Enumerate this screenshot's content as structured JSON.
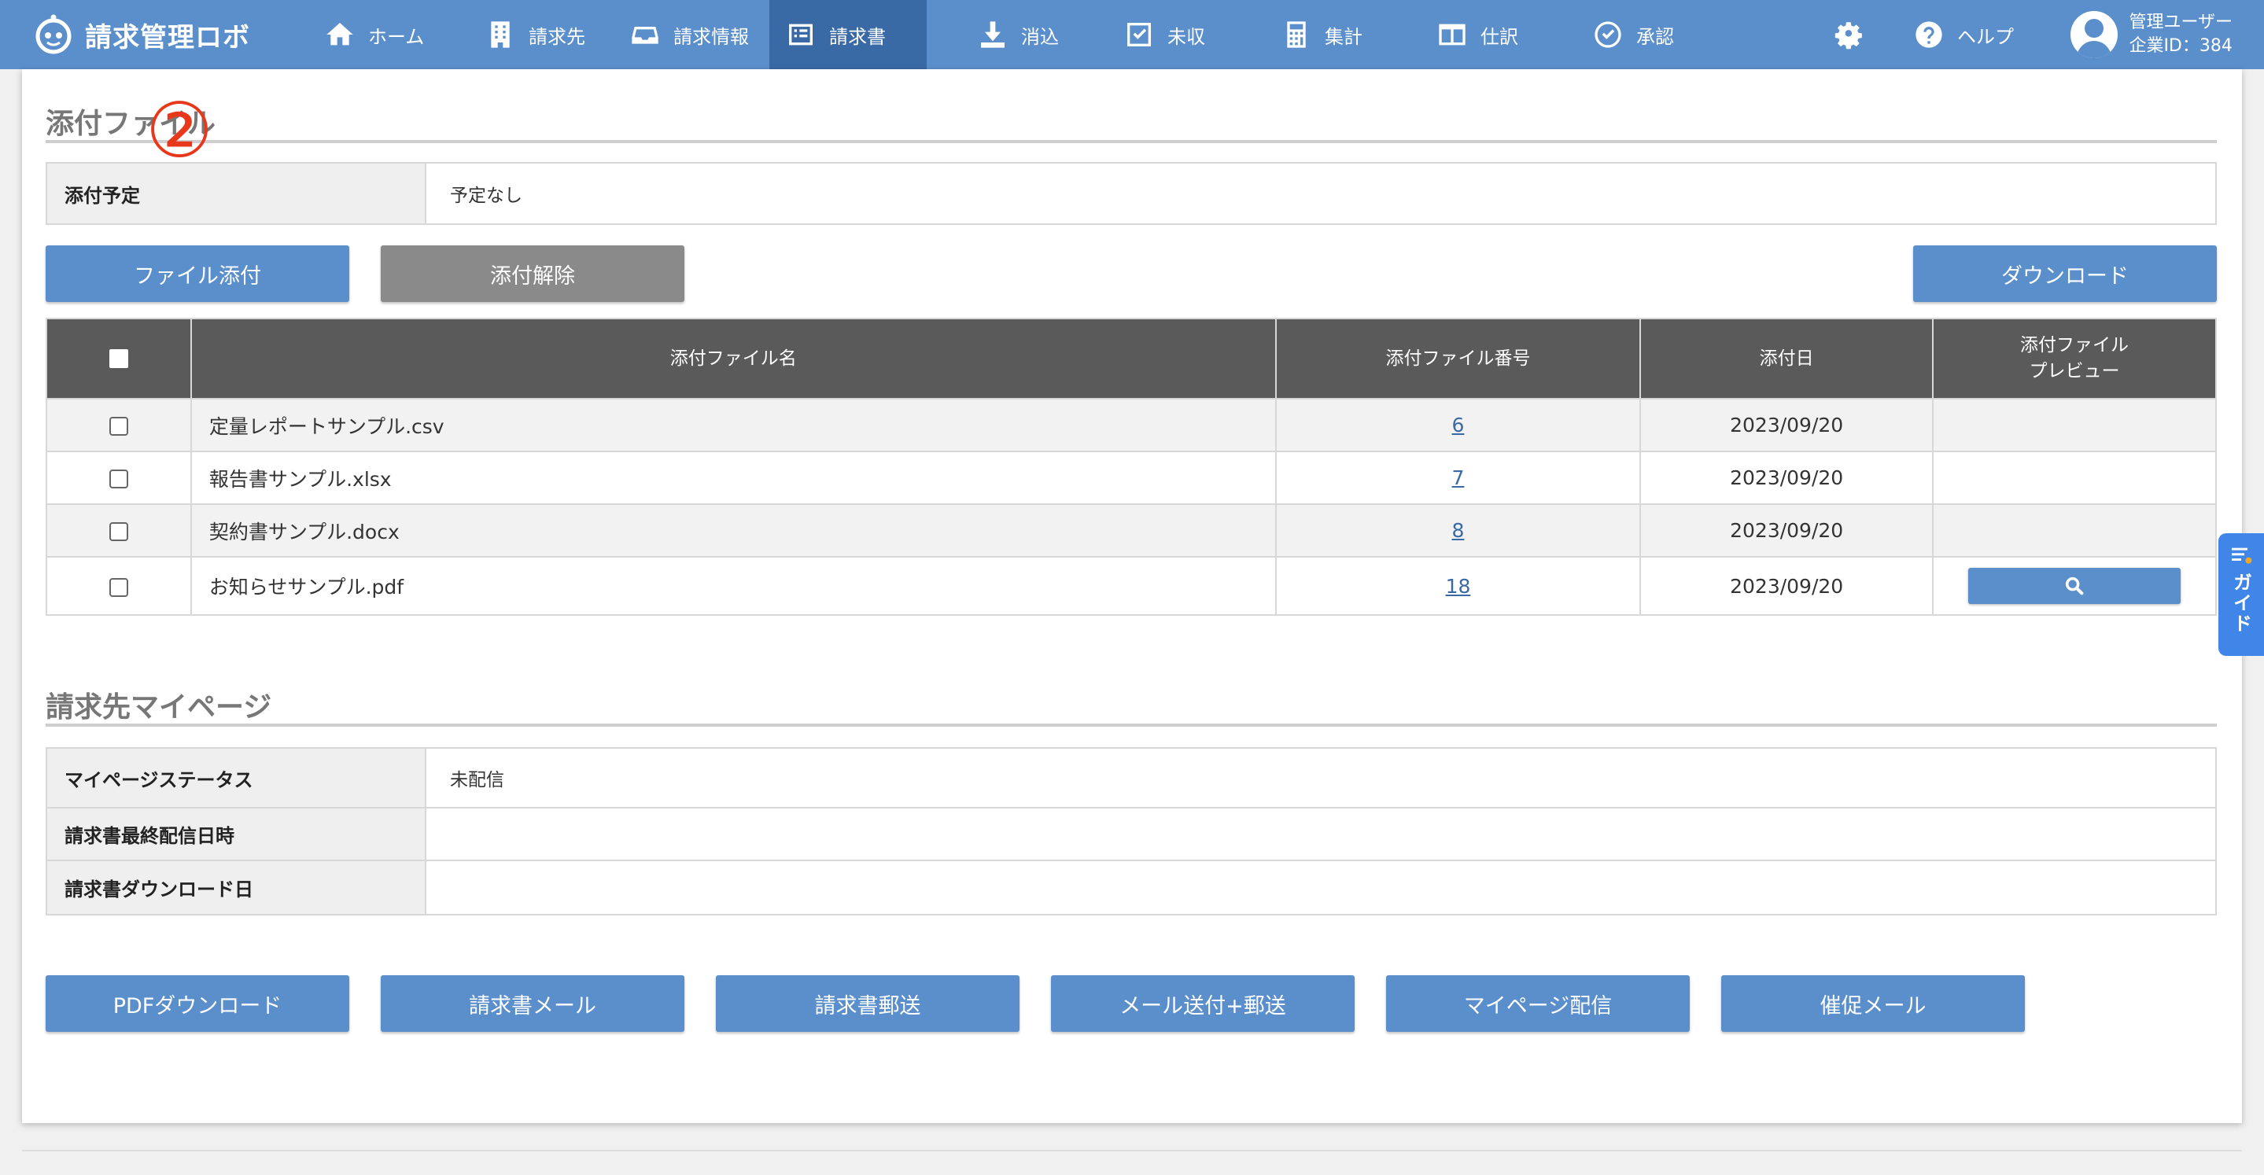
{
  "app": {
    "title": "請求管理ロボ"
  },
  "nav": {
    "items": [
      {
        "label": "ホーム",
        "icon": "home-icon"
      },
      {
        "label": "請求先",
        "icon": "building-icon"
      },
      {
        "label": "請求情報",
        "icon": "inbox-icon"
      },
      {
        "label": "請求書",
        "icon": "list-icon"
      },
      {
        "label": "消込",
        "icon": "download-icon"
      },
      {
        "label": "未収",
        "icon": "checkbox-icon"
      },
      {
        "label": "集計",
        "icon": "calculator-icon"
      },
      {
        "label": "仕訳",
        "icon": "columns-icon"
      },
      {
        "label": "承認",
        "icon": "check-circle-icon"
      }
    ],
    "active": "請求書",
    "help_label": "ヘルプ",
    "user_name": "管理ユーザー",
    "company_id": "企業ID：384"
  },
  "attachments": {
    "section_title": "添付ファイル",
    "schedule_label": "添付予定",
    "schedule_value": "予定なし",
    "marker": "②",
    "attach_button": "ファイル添付",
    "detach_button": "添付解除",
    "download_button": "ダウンロード",
    "columns": [
      "添付ファイル名",
      "添付ファイル番号",
      "添付日",
      "添付ファイル",
      "プレビュー"
    ],
    "rows": [
      {
        "name": "定量レポートサンプル.csv",
        "number": "6",
        "date": "2023/09/20",
        "preview": false
      },
      {
        "name": "報告書サンプル.xlsx",
        "number": "7",
        "date": "2023/09/20",
        "preview": false
      },
      {
        "name": "契約書サンプル.docx",
        "number": "8",
        "date": "2023/09/20",
        "preview": false
      },
      {
        "name": "お知らせサンプル.pdf",
        "number": "18",
        "date": "2023/09/20",
        "preview": true
      }
    ]
  },
  "mypage": {
    "section_title": "請求先マイページ",
    "rows": [
      {
        "label": "マイページステータス",
        "value": "未配信"
      },
      {
        "label": "請求書最終配信日時",
        "value": ""
      },
      {
        "label": "請求書ダウンロード日",
        "value": ""
      }
    ]
  },
  "actions": {
    "pdf": "PDFダウンロード",
    "mail": "請求書メール",
    "post": "請求書郵送",
    "mail_post": "メール送付+郵送",
    "mypage": "マイページ配信",
    "reminder": "催促メール"
  },
  "guide": {
    "label": "ガイド"
  },
  "colors": {
    "nav": "#5b8fcb",
    "nav_active": "#3a6aa6",
    "header_dark": "#5a5a5a",
    "marker": "#e8381c",
    "guide": "#3f86e8"
  }
}
